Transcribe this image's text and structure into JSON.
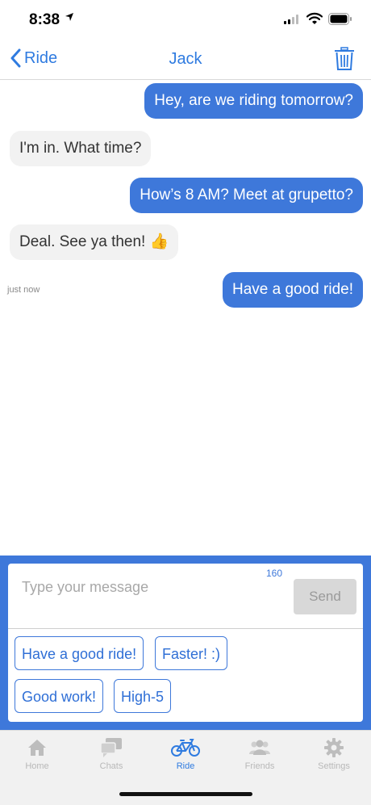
{
  "status_bar": {
    "time": "8:38"
  },
  "nav": {
    "back_label": "Ride",
    "title": "Jack"
  },
  "messages": [
    {
      "direction": "outgoing",
      "text": "Hey, are we riding tomorrow?"
    },
    {
      "direction": "incoming",
      "text": "I'm in. What time?"
    },
    {
      "direction": "outgoing",
      "text": "How’s 8 AM? Meet at grupetto?"
    },
    {
      "direction": "incoming",
      "text": "Deal. See ya then! 👍"
    },
    {
      "direction": "outgoing",
      "text": "Have a good ride!"
    }
  ],
  "timestamp": "just now",
  "composer": {
    "placeholder": "Type your message",
    "char_counter": "160",
    "send_label": "Send"
  },
  "quick_replies": [
    "Have a good ride!",
    "Faster! :)",
    "Good work!",
    "High-5"
  ],
  "tabs": [
    {
      "label": "Home",
      "icon": "home-icon",
      "active": false
    },
    {
      "label": "Chats",
      "icon": "chats-icon",
      "active": false
    },
    {
      "label": "Ride",
      "icon": "bicycle-icon",
      "active": true
    },
    {
      "label": "Friends",
      "icon": "friends-icon",
      "active": false
    },
    {
      "label": "Settings",
      "icon": "gear-icon",
      "active": false
    }
  ],
  "colors": {
    "accent": "#2f7be0",
    "bubble_outgoing": "#3e78da",
    "bubble_incoming": "#f2f2f2"
  }
}
